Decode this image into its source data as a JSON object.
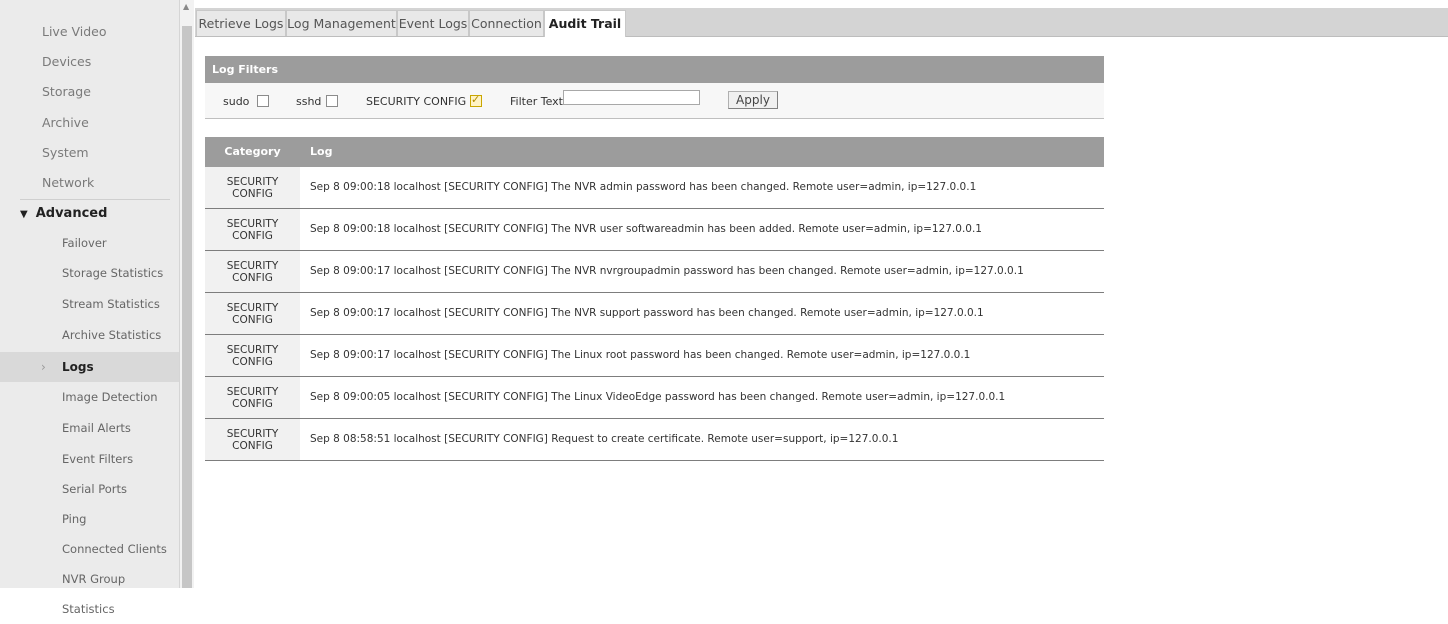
{
  "sidebar": {
    "top_items": [
      "Live Video",
      "Devices",
      "Storage",
      "Archive",
      "System",
      "Network"
    ],
    "section": "Advanced",
    "sub_items": [
      "Failover",
      "Storage Statistics",
      "Stream Statistics",
      "Archive Statistics",
      "Logs",
      "Image Detection",
      "Email Alerts",
      "Event Filters",
      "Serial Ports",
      "Ping",
      "Connected Clients",
      "NVR Group Statistics"
    ],
    "active_item": "Logs"
  },
  "tabs": [
    "Retrieve Logs",
    "Log Management",
    "Event Logs",
    "Connection",
    "Audit Trail"
  ],
  "active_tab": "Audit Trail",
  "filters": {
    "title": "Log Filters",
    "sudo_label": "sudo",
    "sudo_checked": false,
    "sshd_label": "sshd",
    "sshd_checked": false,
    "security_label": "SECURITY CONFIG",
    "security_checked": true,
    "filter_text_label": "Filter Text",
    "filter_text_value": "",
    "apply_label": "Apply"
  },
  "table": {
    "headers": [
      "Category",
      "Log"
    ],
    "rows": [
      {
        "category": "SECURITY CONFIG",
        "log": "Sep 8 09:00:18 localhost [SECURITY CONFIG] The NVR admin password has been changed. Remote user=admin, ip=127.0.0.1"
      },
      {
        "category": "SECURITY CONFIG",
        "log": "Sep 8 09:00:18 localhost [SECURITY CONFIG] The NVR user softwareadmin has been added. Remote user=admin, ip=127.0.0.1"
      },
      {
        "category": "SECURITY CONFIG",
        "log": "Sep 8 09:00:17 localhost [SECURITY CONFIG] The NVR nvrgroupadmin password has been changed. Remote user=admin, ip=127.0.0.1"
      },
      {
        "category": "SECURITY CONFIG",
        "log": "Sep 8 09:00:17 localhost [SECURITY CONFIG] The NVR support password has been changed. Remote user=admin, ip=127.0.0.1"
      },
      {
        "category": "SECURITY CONFIG",
        "log": "Sep 8 09:00:17 localhost [SECURITY CONFIG] The Linux root password has been changed. Remote user=admin, ip=127.0.0.1"
      },
      {
        "category": "SECURITY CONFIG",
        "log": "Sep 8 09:00:05 localhost [SECURITY CONFIG] The Linux VideoEdge password has been changed. Remote user=admin, ip=127.0.0.1"
      },
      {
        "category": "SECURITY CONFIG",
        "log": "Sep 8 08:58:51 localhost [SECURITY CONFIG] Request to create certificate. Remote user=support, ip=127.0.0.1"
      }
    ]
  },
  "colors": {
    "header_gray": "#9c9c9c",
    "sidebar_bg": "#ebebeb",
    "check_accent": "#c9a600"
  }
}
